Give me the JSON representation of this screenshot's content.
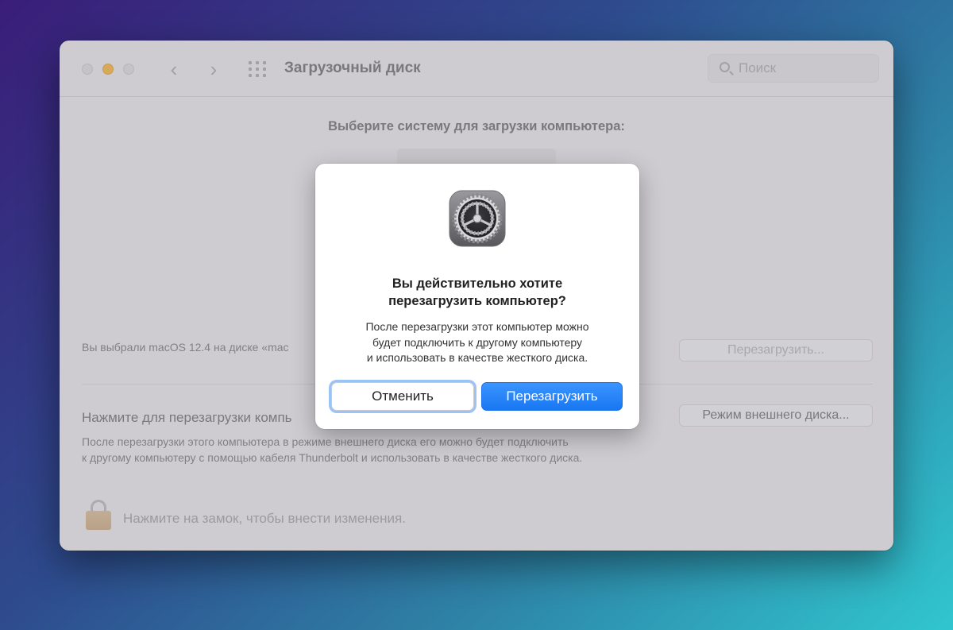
{
  "window": {
    "title": "Загрузочный диск",
    "search_placeholder": "Поиск"
  },
  "main": {
    "heading": "Выберите систему для загрузки компьютера:",
    "selected_text": "Вы выбрали macOS 12.4 на диске «mac",
    "restart_button": "Перезагрузить...",
    "target_title": "Нажмите для перезагрузки компь",
    "target_button": "Режим внешнего диска...",
    "target_description_line1": "После перезагрузки этого компьютера в режиме внешнего диска его можно будет подключить",
    "target_description_line2": "к другому компьютеру с помощью кабеля Thunderbolt и использовать в качестве жесткого диска.",
    "lock_text": "Нажмите на замок, чтобы внести изменения."
  },
  "dialog": {
    "icon": "system-preferences-gear-icon",
    "title_line1": "Вы действительно хотите",
    "title_line2": "перезагрузить компьютер?",
    "message_line1": "После перезагрузки этот компьютер можно",
    "message_line2": "будет подключить к другому компьютеру",
    "message_line3": "и использовать в качестве жесткого диска.",
    "cancel_label": "Отменить",
    "confirm_label": "Перезагрузить"
  },
  "colors": {
    "accent": "#1877f2",
    "minimize": "#f6b53c"
  }
}
